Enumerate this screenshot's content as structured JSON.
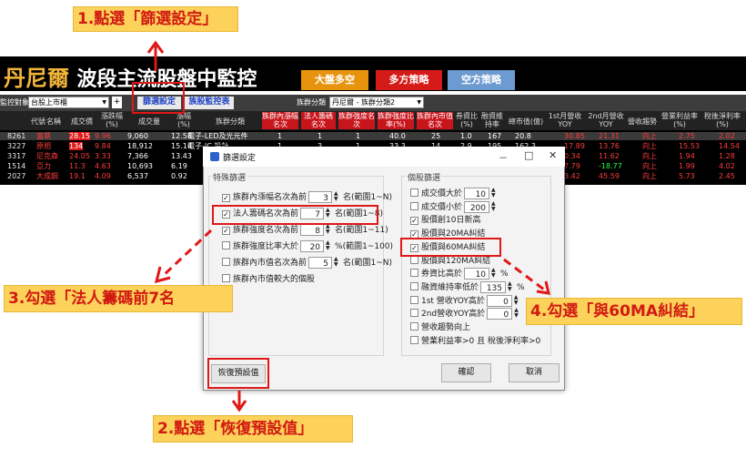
{
  "callouts": {
    "step1": "1.點選「篩選設定」",
    "step2": "2.點選「恢復預設值」",
    "step3": "3.勾選「法人籌碼前7名",
    "step4": "4.勾選「與60MA糾結」"
  },
  "app": {
    "title_prefix": "丹尼爾",
    "title_main": "波段主流股盤中監控",
    "strategy_buttons": [
      "大盤多空",
      "多方策略",
      "空方策略"
    ]
  },
  "toolbar": {
    "monitor_label": "監控對象",
    "monitor_value": "台股上市櫃",
    "add_symbol": "+",
    "filter_settings": "篩選設定",
    "group_monitor": "族股監控表",
    "group_class_label": "族群分類",
    "group_class_value": "丹尼爾 - 族群分類2"
  },
  "table": {
    "headers": [
      "代號",
      "名稱",
      "成交價",
      "漲跌幅(%)",
      "成交量",
      "漲幅(%)",
      "族群分類",
      "族群內漲幅名次",
      "法人籌碼名次",
      "族群強度名次",
      "族群強度比率(%)",
      "族群內市值名次",
      "券資比(%)",
      "融資維持率",
      "總市值(億)",
      "1st月營收YOY",
      "2nd月營收YOY",
      "營收趨勢",
      "營業利益率(%)",
      "稅後淨利率(%)"
    ],
    "rows": [
      {
        "code": "8261",
        "name": "富鼎",
        "price": "28.15",
        "chg": "9.96",
        "vol": "9,060",
        "pct": "12.58",
        "group": "電子-LED及光元件",
        "r1": "1",
        "r2": "1",
        "r3": "1",
        "r4": "40.0",
        "r5": "25",
        "r6": "1.0",
        "r7": "167",
        "r8": "20.8",
        "r9": "30.85",
        "r10": "21.31",
        "r11": "向上",
        "r12": "2.75",
        "r13": "2.02"
      },
      {
        "code": "3227",
        "name": "原相",
        "price": "134",
        "chg": "9.84",
        "vol": "18,912",
        "pct": "15.14",
        "group": "電子-IC 設計",
        "r1": "1",
        "r2": "3",
        "r3": "1",
        "r4": "33.3",
        "r5": "14",
        "r6": "2.9",
        "r7": "195",
        "r8": "162.3",
        "r9": "17.89",
        "r10": "13.76",
        "r11": "向上",
        "r12": "15.53",
        "r13": "14.54"
      },
      {
        "code": "3317",
        "name": "尼克森",
        "price": "24.05",
        "chg": "3.33",
        "vol": "7,366",
        "pct": "13.43",
        "group": "",
        "r1": "",
        "r2": "",
        "r3": "",
        "r4": "",
        "r5": "",
        "r6": "",
        "r7": "",
        "r8": "",
        "r9": "0.34",
        "r10": "11.62",
        "r11": "向上",
        "r12": "1.94",
        "r13": "1.28"
      },
      {
        "code": "1514",
        "name": "亞力",
        "price": "11.3",
        "chg": "4.63",
        "vol": "10,693",
        "pct": "6.19",
        "group": "",
        "r1": "",
        "r2": "",
        "r3": "",
        "r4": "",
        "r5": "",
        "r6": "",
        "r7": "",
        "r8": "",
        "r9": "7.79",
        "r10": "-18.77",
        "r11": "向上",
        "r12": "1.99",
        "r13": "4.02"
      },
      {
        "code": "2027",
        "name": "大成鋼",
        "price": "19.1",
        "chg": "4.09",
        "vol": "6,537",
        "pct": "0.92",
        "group": "",
        "r1": "",
        "r2": "",
        "r3": "",
        "r4": "",
        "r5": "",
        "r6": "",
        "r7": "",
        "r8": "",
        "r9": "3.42",
        "r10": "45.59",
        "r11": "向上",
        "r12": "5.73",
        "r13": "2.45"
      }
    ]
  },
  "dialog": {
    "title": "篩選設定",
    "win_minimize": "－",
    "win_maximize": "□",
    "win_close": "✕",
    "special_group": "特殊篩選",
    "special": [
      {
        "checked": "✓",
        "label": "族群內漲幅名次為前",
        "value": "3",
        "suffix": "名(範圍1~N)"
      },
      {
        "checked": "✓",
        "label": "法人籌碼名次為前",
        "value": "7",
        "suffix": "名(範圍1~8)"
      },
      {
        "checked": "✓",
        "label": "族群強度名次為前",
        "value": "8",
        "suffix": "名(範圍1~11)"
      },
      {
        "checked": "",
        "label": "族群強度比率大於",
        "value": "20",
        "suffix": "%(範圍1~100)"
      },
      {
        "checked": "",
        "label": "族群內市值名次為前",
        "value": "5",
        "suffix": "名(範圍1~N)"
      },
      {
        "checked": "",
        "label": "族群內市值較大的個股",
        "value": "",
        "suffix": ""
      }
    ],
    "stock_group": "個股篩選",
    "stock": [
      {
        "checked": "",
        "label": "成交價大於",
        "value": "10",
        "suffix": ""
      },
      {
        "checked": "",
        "label": "成交價小於",
        "value": "200",
        "suffix": ""
      },
      {
        "checked": "✓",
        "label": "股價創10日新高",
        "value": "",
        "suffix": ""
      },
      {
        "checked": "✓",
        "label": "股價與20MA糾結",
        "value": "",
        "suffix": ""
      },
      {
        "checked": "✓",
        "label": "股價與60MA糾結",
        "value": "",
        "suffix": ""
      },
      {
        "checked": "",
        "label": "股價與120MA糾結",
        "value": "",
        "suffix": ""
      },
      {
        "checked": "",
        "label": "券資比高於",
        "value": "10",
        "suffix": "%"
      },
      {
        "checked": "",
        "label": "融資維持率低於",
        "value": "135",
        "suffix": "%"
      },
      {
        "checked": "",
        "label": "1st 營收YOY高於",
        "value": "0",
        "suffix": ""
      },
      {
        "checked": "",
        "label": "2nd營收YOY高於",
        "value": "0",
        "suffix": ""
      },
      {
        "checked": "",
        "label": "營收趨勢向上",
        "value": "",
        "suffix": ""
      },
      {
        "checked": "",
        "label": "營業利益率>0 且 稅後淨利率>0",
        "value": "",
        "suffix": ""
      }
    ],
    "restore_default": "恢復預設值",
    "confirm": "確認",
    "cancel": "取消"
  },
  "colors": {
    "callout_bg": "#fcd25a",
    "callout_text": "#d11a12",
    "highlight": "#e01818",
    "header_red": "#c8141b"
  }
}
